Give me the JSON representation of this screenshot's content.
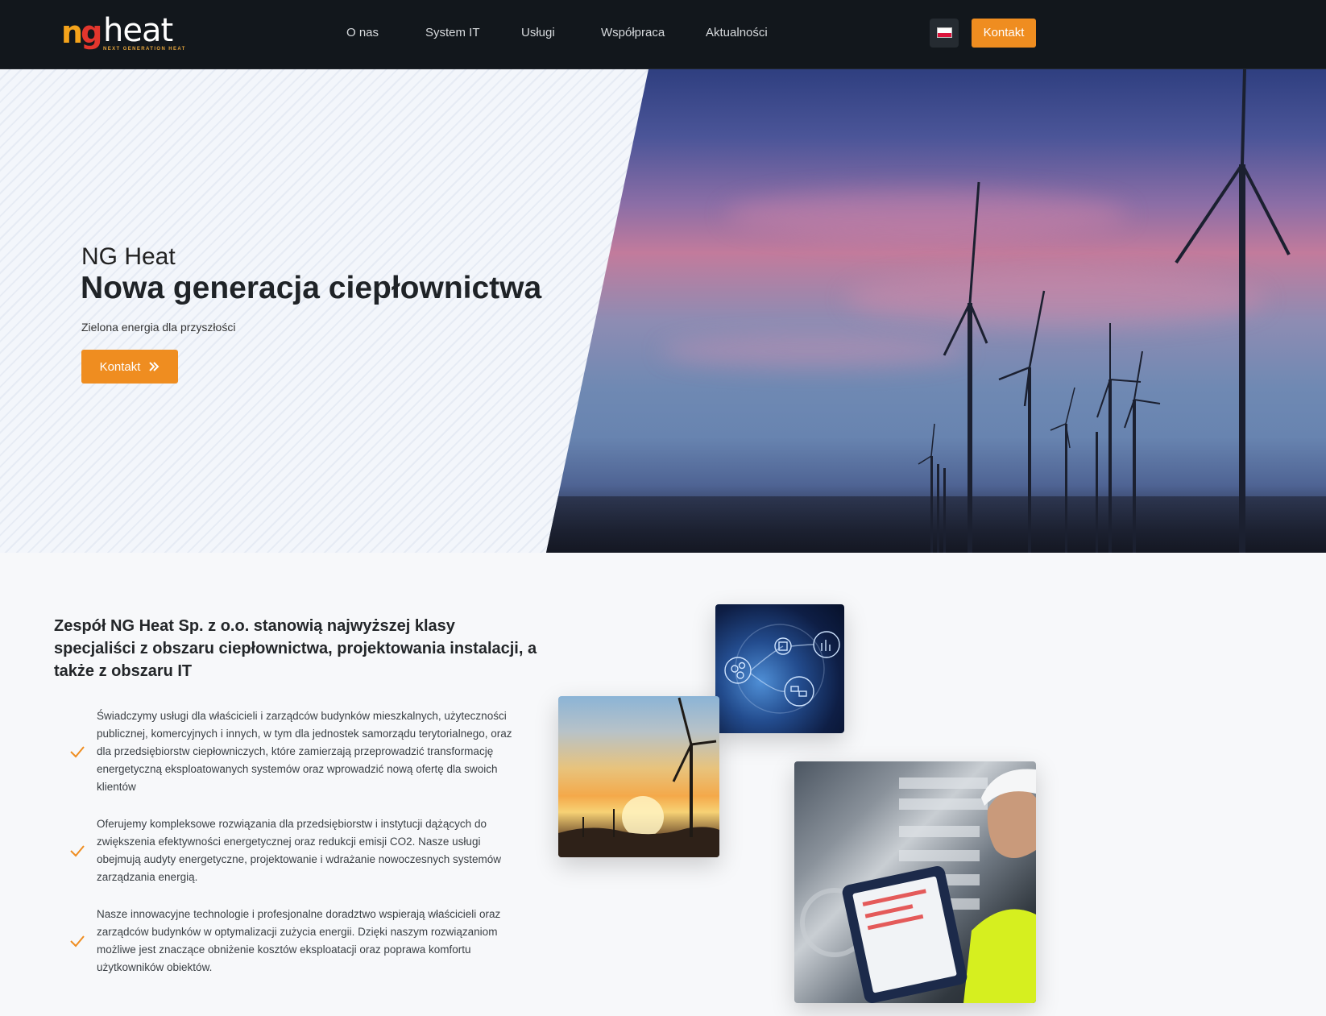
{
  "brand": {
    "logo_mark_n": "n",
    "logo_mark_g": "g",
    "logo_word": "heat",
    "logo_tagline": "NEXT GENERATION HEAT"
  },
  "nav": {
    "links": [
      "O nas",
      "System IT",
      "Usługi",
      "Współpraca",
      "Aktualności"
    ],
    "language_flag": "poland-flag-icon",
    "cta_label": "Kontakt"
  },
  "hero": {
    "title_small": "NG Heat",
    "title": "Nowa generacja ciepłownictwa",
    "subtitle": "Zielona energia dla przyszłości",
    "button_label": "Kontakt",
    "button_icon": "double-chevron-right-icon"
  },
  "about": {
    "title": "Zespół NG Heat Sp. z o.o. stanowią najwyższej klasy specjaliści z obszaru ciepłownictwa, projektowania instalacji, a także z obszaru IT",
    "features": [
      "Świadczymy usługi dla właścicieli i zarządców budynków mieszkalnych, użyteczności publicznej, komercyjnych i innych, w tym dla jednostek samorządu terytorialnego, oraz dla przedsiębiorstw ciepłowniczych, które zamierzają przeprowadzić transformację energetyczną eksploatowanych systemów oraz wprowadzić nową ofertę dla swoich klientów",
      "Oferujemy kompleksowe rozwiązania dla przedsiębiorstw i instytucji dążących do zwiększenia efektywności energetycznej oraz redukcji emisji CO2. Nasze usługi obejmują audyty energetyczne, projektowanie i wdrażanie nowoczesnych systemów zarządzania energią.",
      "Nasze innowacyjne technologie i profesjonalne doradztwo wspierają właścicieli oraz zarządców budynków w optymalizacji zużycia energii. Dzięki naszym rozwiązaniom możliwe jest znaczące obniżenie kosztów eksploatacji oraz poprawa komfortu użytkowników obiektów."
    ],
    "feature_icon": "check-icon"
  },
  "colors": {
    "accent": "#ef8d20",
    "navbar": "#12171c"
  }
}
